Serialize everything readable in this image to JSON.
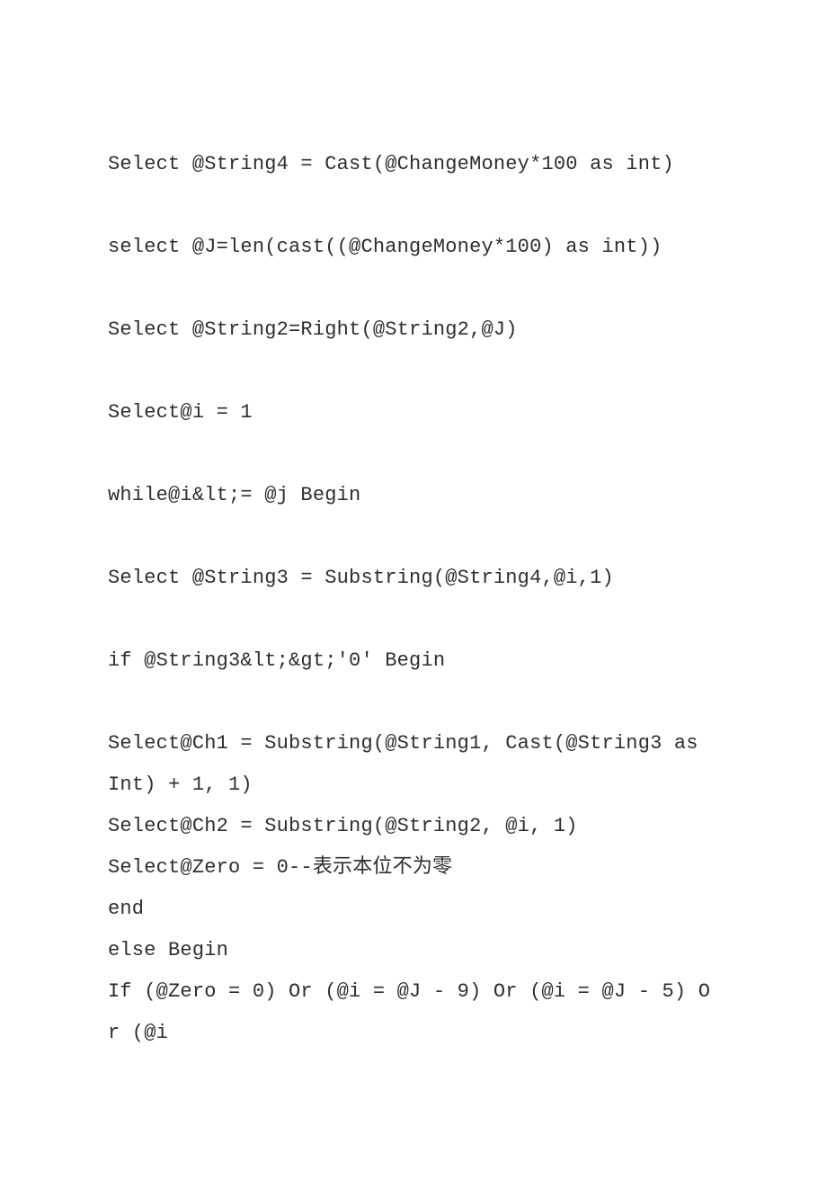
{
  "code": {
    "lines": [
      "Select @String4 = Cast(@ChangeMoney*100 as int)",
      "",
      "select @J=len(cast((@ChangeMoney*100) as int))",
      "",
      "Select @String2=Right(@String2,@J)",
      "",
      "Select@i = 1",
      "",
      "while@i&lt;= @j Begin",
      "",
      "Select @String3 = Substring(@String4,@i,1)",
      "",
      "if @String3&lt;&gt;'0' Begin",
      "",
      "Select@Ch1 = Substring(@String1, Cast(@String3 as Int) + 1, 1)",
      "Select@Ch2 = Substring(@String2, @i, 1)",
      "Select@Zero = 0--表示本位不为零",
      "end",
      "else Begin",
      "If (@Zero = 0) Or (@i = @J - 9) Or (@i = @J - 5) Or (@i"
    ]
  }
}
